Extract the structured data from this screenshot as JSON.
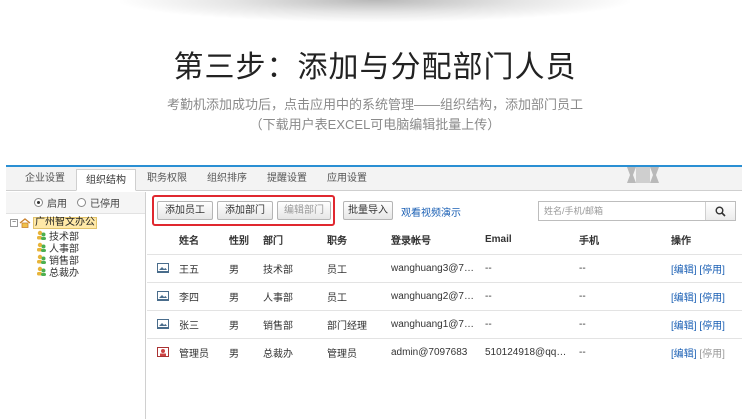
{
  "heading": "第三步：添加与分配部门人员",
  "subtitle": {
    "line1": "考勤机添加成功后，点击应用中的系统管理——组织结构，添加部门员工",
    "line2": "（下载用户表EXCEL可电脑编辑批量上传）"
  },
  "tabs": [
    {
      "label": "企业设置"
    },
    {
      "label": "组织结构"
    },
    {
      "label": "职务权限"
    },
    {
      "label": "组织排序"
    },
    {
      "label": "提醒设置"
    },
    {
      "label": "应用设置"
    }
  ],
  "active_tab": "组织结构",
  "filter": {
    "enabled_label": "启用",
    "disabled_label": "已停用",
    "selected": "启用"
  },
  "tree": {
    "root": "广州智文办公",
    "children": [
      "技术部",
      "人事部",
      "销售部",
      "总裁办"
    ]
  },
  "toolbar": {
    "add_employee": "添加员工",
    "add_department": "添加部门",
    "edit_department": "编辑部门",
    "batch_import": "批量导入",
    "video_link": "观看视频演示",
    "search_placeholder": "姓名/手机/邮箱"
  },
  "table": {
    "columns": [
      "姓名",
      "性别",
      "部门",
      "职务",
      "登录帐号",
      "Email",
      "手机",
      "操作"
    ],
    "rows": [
      {
        "icon": "user-card-icon",
        "name": "王五",
        "gender": "男",
        "dept": "技术部",
        "title": "员工",
        "account": "wanghuang3@7…",
        "email": "--",
        "phone": "--",
        "edit": "[编辑]",
        "disable": "[停用]"
      },
      {
        "icon": "user-card-icon",
        "name": "李四",
        "gender": "男",
        "dept": "人事部",
        "title": "员工",
        "account": "wanghuang2@7…",
        "email": "--",
        "phone": "--",
        "edit": "[编辑]",
        "disable": "[停用]"
      },
      {
        "icon": "user-card-icon",
        "name": "张三",
        "gender": "男",
        "dept": "销售部",
        "title": "部门经理",
        "account": "wanghuang1@7…",
        "email": "--",
        "phone": "--",
        "edit": "[编辑]",
        "disable": "[停用]"
      },
      {
        "icon": "admin-card-icon",
        "name": "管理员",
        "gender": "男",
        "dept": "总裁办",
        "title": "管理员",
        "account": "admin@7097683",
        "email": "510124918@qq…",
        "phone": "--",
        "edit": "[编辑]",
        "disable": "[停用]"
      }
    ]
  },
  "colors": {
    "accent": "#2a8fd3",
    "link": "#1a5fb4",
    "highlight": "#e0282f"
  }
}
